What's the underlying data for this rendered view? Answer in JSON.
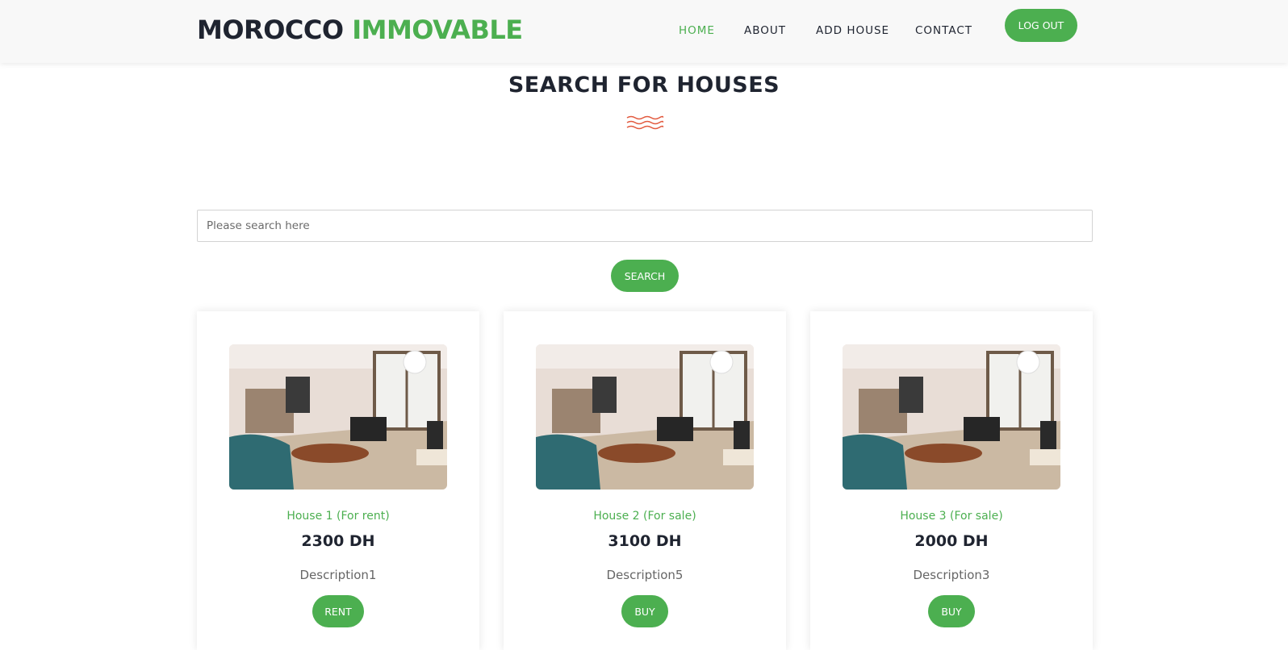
{
  "header": {
    "brand_part1": "MOROCCO",
    "brand_part2": "IMMOVABLE",
    "nav": [
      "HOME",
      "ABOUT",
      "ADD HOUSE",
      "CONTACT"
    ],
    "active_nav": "HOME",
    "logout_label": "LOG OUT"
  },
  "search": {
    "heading": "SEARCH FOR HOUSES",
    "placeholder": "Please search here",
    "button_label": "SEARCH"
  },
  "listings": [
    {
      "title": "House 1 (For rent)",
      "price": "2300 DH",
      "description": "Description1",
      "button": "RENT"
    },
    {
      "title": "House 2 (For sale)",
      "price": "3100 DH",
      "description": "Description5",
      "button": "BUY"
    },
    {
      "title": "House 3 (For sale)",
      "price": "2000 DH",
      "description": "Description3",
      "button": "BUY"
    }
  ],
  "colors": {
    "accent": "#4caf50",
    "dark": "#1f2430",
    "wave": "#e25a3f"
  },
  "icons": {
    "divider": "wave-divider-icon"
  }
}
